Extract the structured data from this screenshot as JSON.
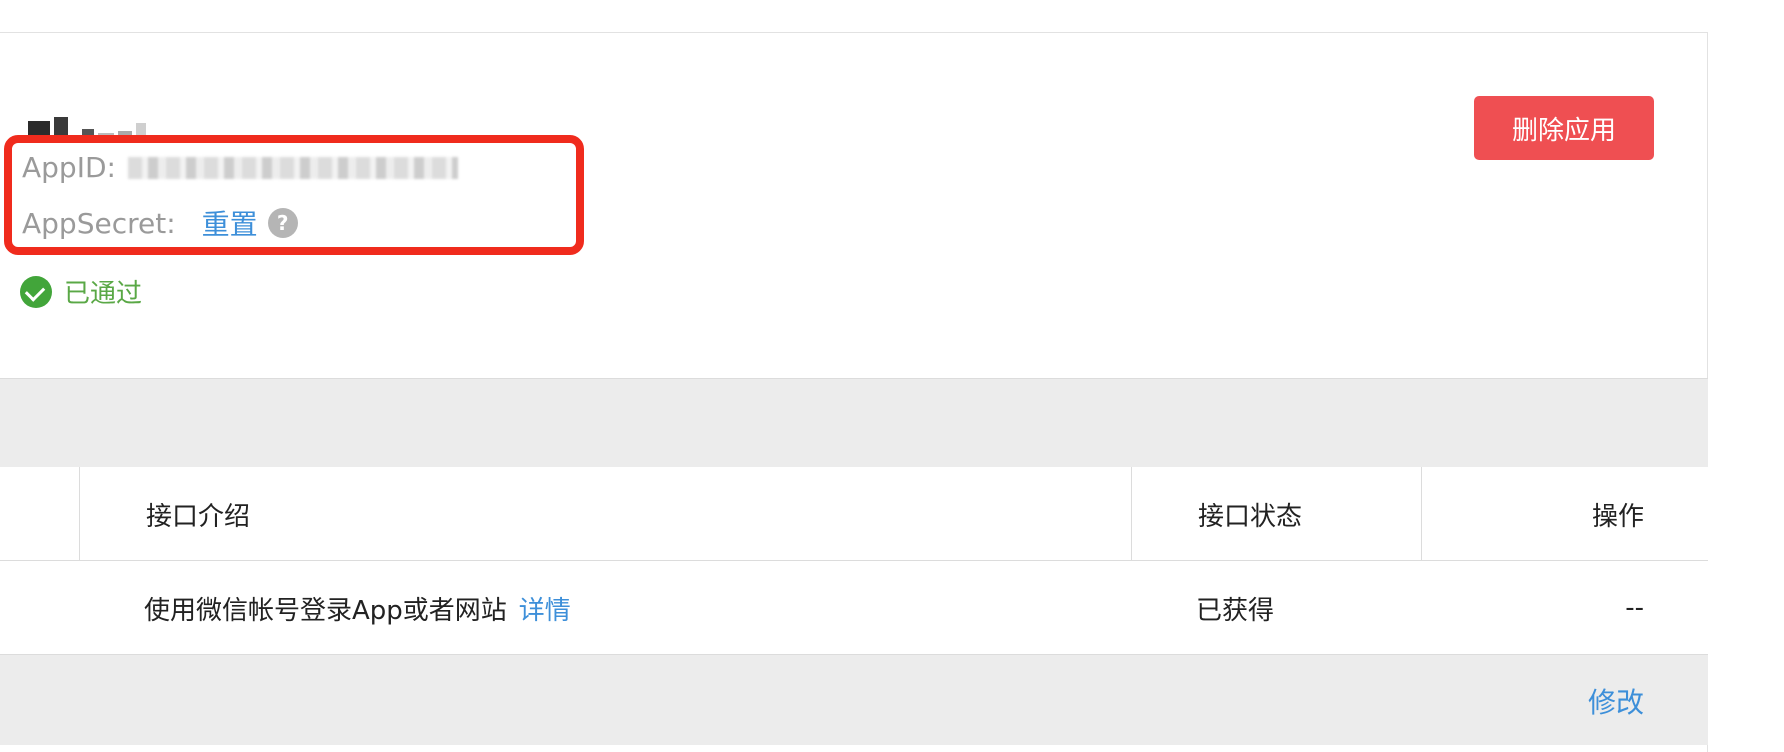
{
  "app": {
    "appid_label": "AppID:",
    "appsecret_label": "AppSecret:",
    "reset_label": "重置",
    "help_icon": "question-circle-icon",
    "status_label": "已通过",
    "status_icon": "check-circle-icon",
    "delete_button_label": "删除应用"
  },
  "colors": {
    "delete_button": "#ef4f52",
    "link": "#3d8fd9",
    "status_green": "#5aa846",
    "highlight_red": "#f02b1d",
    "band_gray": "#ececec"
  },
  "table": {
    "headers": [
      "接口介绍",
      "接口状态",
      "操作"
    ],
    "rows": [
      {
        "description": "使用微信帐号登录App或者网站",
        "detail_link": "详情",
        "status": "已获得",
        "action": "--"
      }
    ],
    "footer_link": "修改"
  }
}
